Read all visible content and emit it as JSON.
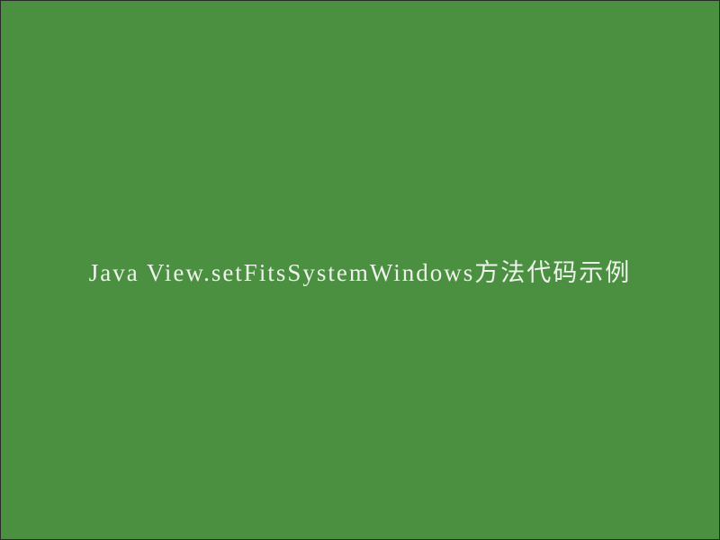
{
  "title": "Java View.setFitsSystemWindows方法代码示例"
}
